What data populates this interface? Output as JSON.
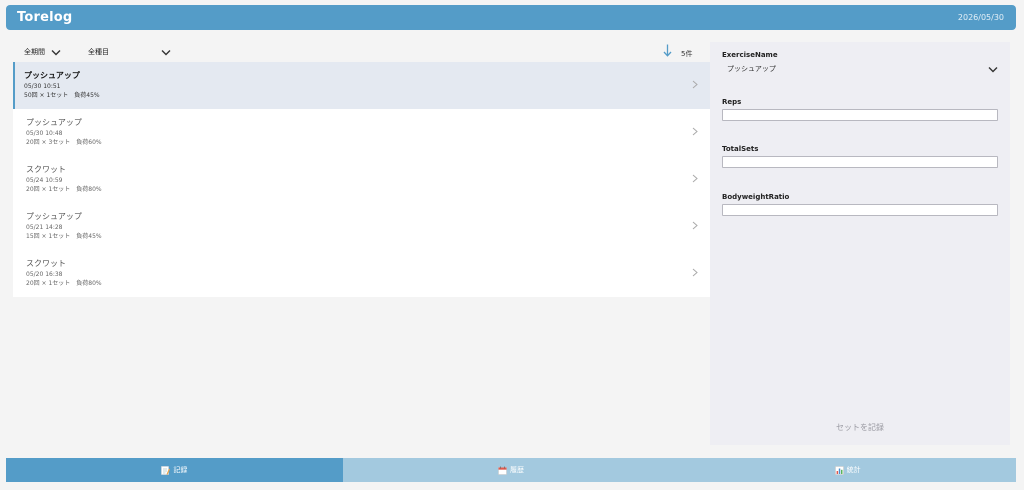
{
  "header": {
    "title": "Torelog",
    "date": "2026/05/30"
  },
  "filters": {
    "period": "全期間",
    "category": "全種目"
  },
  "list_meta": {
    "count": "5件"
  },
  "records": [
    {
      "name": "プッシュアップ",
      "time": "05/30 10:51",
      "detail": "50回 × 1セット　負荷45%"
    },
    {
      "name": "プッシュアップ",
      "time": "05/30 10:48",
      "detail": "20回 × 3セット　負荷60%"
    },
    {
      "name": "スクワット",
      "time": "05/24 10:59",
      "detail": "20回 × 1セット　負荷80%"
    },
    {
      "name": "プッシュアップ",
      "time": "05/21 14:28",
      "detail": "15回 × 1セット　負荷45%"
    },
    {
      "name": "スクワット",
      "time": "05/20 16:38",
      "detail": "20回 × 1セット　負荷80%"
    }
  ],
  "form": {
    "exercise_label": "ExerciseName",
    "exercise_value": "プッシュアップ",
    "reps_label": "Reps",
    "reps_value": "",
    "sets_label": "TotalSets",
    "sets_value": "",
    "ratio_label": "BodyweightRatio",
    "ratio_value": "",
    "submit_label": "セットを記録"
  },
  "tabs": [
    {
      "label": "記録",
      "icon": "memo-icon"
    },
    {
      "label": "履歴",
      "icon": "calendar-icon"
    },
    {
      "label": "統計",
      "icon": "bar-chart-icon"
    }
  ],
  "colors": {
    "accent": "#549cc8",
    "tab_inactive": "#a3c9df",
    "selected_row": "#e4e9f1"
  }
}
